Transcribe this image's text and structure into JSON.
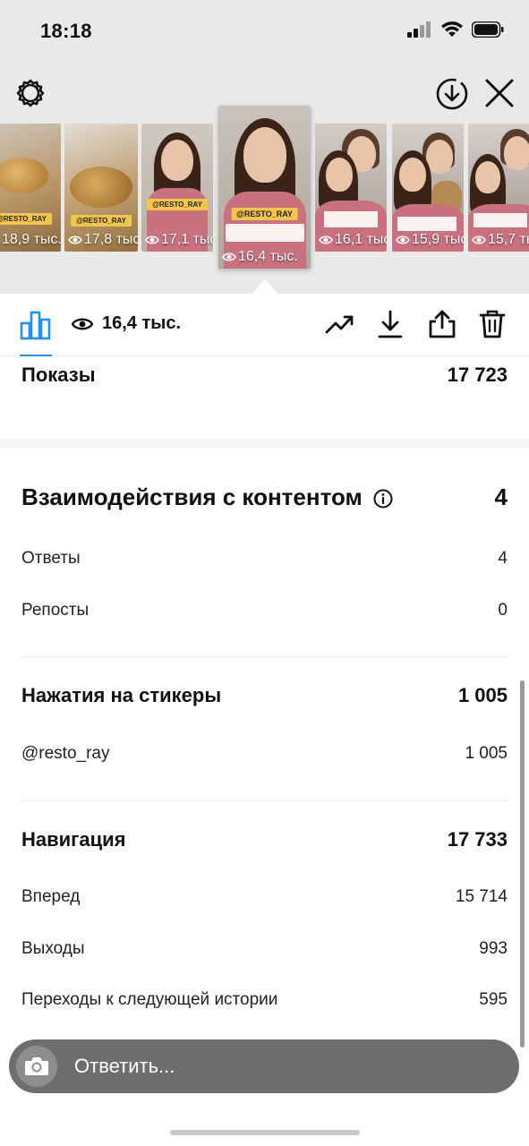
{
  "status_bar": {
    "time": "18:18"
  },
  "thumbnails": [
    {
      "views": "18,9 тыс.",
      "tag": "@RESTO_RAY",
      "theme": "food"
    },
    {
      "views": "17,8 тыс.",
      "tag": "@RESTO_RAY",
      "theme": "food"
    },
    {
      "views": "17,1 тыс.",
      "tag": "@RESTO_RAY",
      "theme": "woman"
    },
    {
      "views": "16,4 тыс.",
      "tag": "@RESTO_RAY",
      "theme": "woman-active"
    },
    {
      "views": "16,1 тыс.",
      "tag": "",
      "theme": "couple"
    },
    {
      "views": "15,9 тыс.",
      "tag": "",
      "theme": "couple"
    },
    {
      "views": "15,7 тыс.",
      "tag": "",
      "theme": "couple"
    }
  ],
  "toolbar": {
    "view_count": "16,4 тыс."
  },
  "stats": {
    "impressions": {
      "label": "Показы",
      "value": "17 723"
    },
    "interactions": {
      "label": "Взаимодействия с контентом",
      "value": "4",
      "rows": [
        {
          "label": "Ответы",
          "value": "4"
        },
        {
          "label": "Репосты",
          "value": "0"
        }
      ]
    },
    "sticker_taps": {
      "label": "Нажатия на стикеры",
      "value": "1 005",
      "rows": [
        {
          "label": "@resto_ray",
          "value": "1 005"
        }
      ]
    },
    "navigation": {
      "label": "Навигация",
      "value": "17 733",
      "rows": [
        {
          "label": "Вперед",
          "value": "15 714"
        },
        {
          "label": "Выходы",
          "value": "993"
        },
        {
          "label": "Переходы к следующей истории",
          "value": "595"
        }
      ]
    }
  },
  "reply": {
    "placeholder": "Ответить..."
  },
  "colors": {
    "accent": "#1e90ff",
    "top_bg": "#e9e9e9",
    "reply_bg": "#6e6e6e"
  }
}
